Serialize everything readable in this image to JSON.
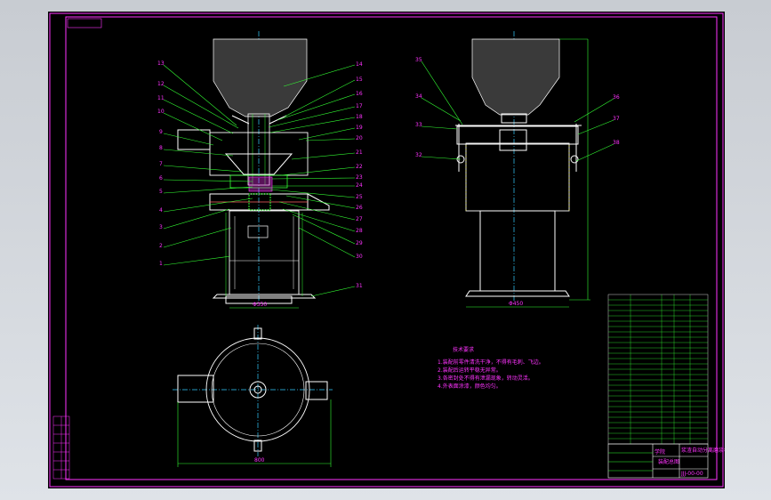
{
  "drawing": {
    "front_view_labels_left": [
      "13",
      "12",
      "11",
      "10",
      "9",
      "8",
      "7",
      "6",
      "5",
      "4",
      "3",
      "2",
      "1"
    ],
    "front_view_labels_right": [
      "14",
      "15",
      "16",
      "17",
      "18",
      "19",
      "20",
      "21",
      "22",
      "23",
      "24",
      "25",
      "26",
      "27",
      "28",
      "29",
      "30",
      "31"
    ],
    "side_view_labels_left": [
      "35",
      "34",
      "33",
      "32"
    ],
    "side_view_labels_right": [
      "36",
      "37",
      "38"
    ],
    "dim_front_bottom": "Φ350",
    "dim_side_bottom": "Φ450",
    "dim_plan_bottom": "800"
  },
  "notes": {
    "title": "技术要求",
    "lines": [
      "1.装配前零件清洗干净，不得有毛刺、飞边。",
      "2.装配后运转平稳无异常。",
      "3.各密封处不得有泄漏现象，转动灵活。",
      "4.外表面涂漆，颜色均匀。"
    ]
  },
  "title_block": {
    "name_line1": "浆渣自动分离磨浆机",
    "name_line2": "装配总图",
    "school": "学院",
    "drawing_no": "JJJ-00-00"
  },
  "colors": {
    "line_magenta": "#ff33ff",
    "line_green": "#33ff33",
    "line_white": "#ffffff",
    "centerline": "#33ccff",
    "background": "#000000"
  }
}
